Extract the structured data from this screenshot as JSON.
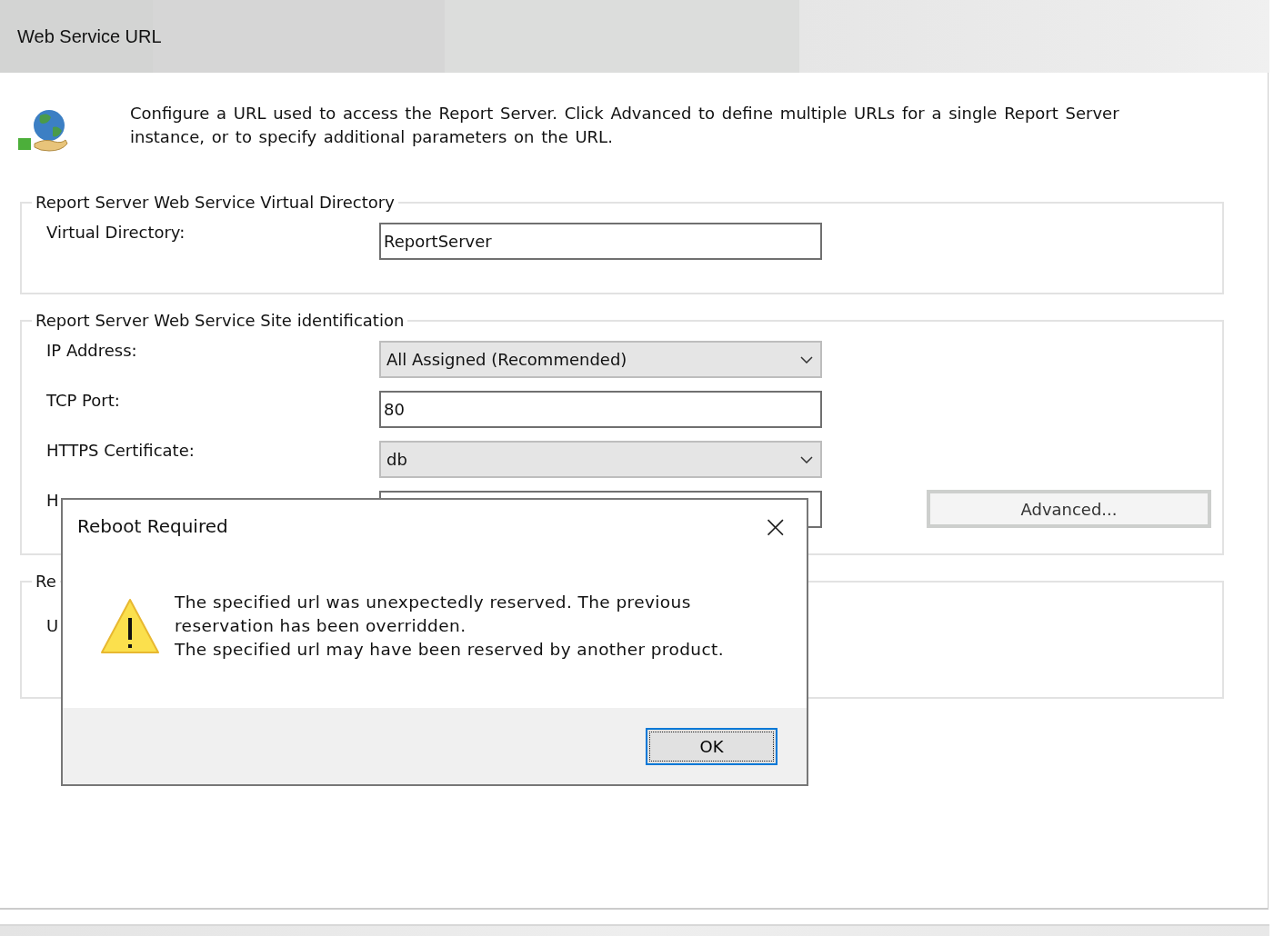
{
  "page": {
    "title": "Web Service URL"
  },
  "intro": {
    "text": "Configure a URL used to access the Report Server.  Click Advanced to define multiple URLs for a single Report Server instance, or to specify additional parameters on the URL."
  },
  "groups": [
    {
      "legend": "Report Server Web Service Virtual Directory",
      "fields": [
        {
          "kind": "text",
          "label": "Virtual Directory:",
          "value": "ReportServer"
        }
      ]
    },
    {
      "legend": "Report Server Web Service Site identification",
      "fields": [
        {
          "kind": "dropdown",
          "label": "IP Address:",
          "value": "All Assigned (Recommended)"
        },
        {
          "kind": "text",
          "label": "TCP Port:",
          "value": "80"
        },
        {
          "kind": "dropdown",
          "label": "HTTPS Certificate:",
          "value": "db"
        },
        {
          "kind": "text",
          "label": "H"
        }
      ],
      "button": "Advanced..."
    },
    {
      "legend": "Re",
      "fields": [
        {
          "kind": "label",
          "label": "U"
        }
      ]
    }
  ],
  "dialog": {
    "title": "Reboot Required",
    "close": "×",
    "message": [
      "The specified url was unexpectedly reserved. The previous reservation has been overridden.",
      "The specified url may have been reserved by another product."
    ],
    "button": "OK"
  }
}
